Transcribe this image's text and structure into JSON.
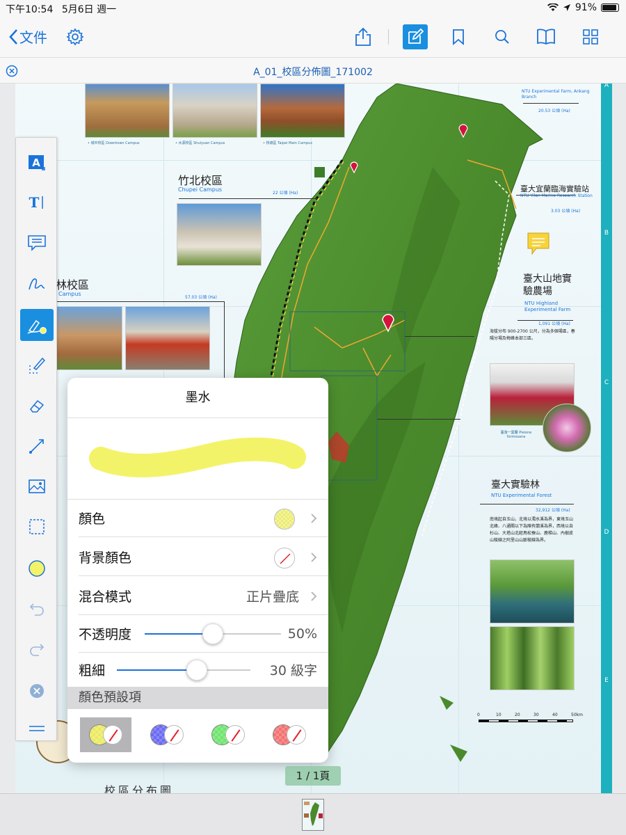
{
  "status_bar": {
    "time": "下午10:54",
    "date": "5月6日 週一",
    "battery": "91%",
    "battery_level": 0.91
  },
  "toolbar": {
    "back_label": "文件"
  },
  "document": {
    "title": "A_01_校區分佈圖_171002",
    "page_indicator": "1 / 1頁"
  },
  "map": {
    "side_letters": [
      "A",
      "B",
      "C",
      "D",
      "E"
    ],
    "captions": {
      "downtown": "• 城中校區 Downtown Campus",
      "shuiyuan": "• 水源校區 Shuiyuan Campus",
      "main": "• 校總區 Taipei Main Campus"
    },
    "chupei": {
      "title": "竹北校區",
      "subtitle": "Chupei Campus",
      "area": "22 公頃 (Ha)"
    },
    "yunlin": {
      "title": "林校區",
      "subtitle": "Campus",
      "area": "57.03 公頃 (Ha)"
    },
    "ankang": {
      "subtitle": "NTU Experimental Farm, Ankang Branch",
      "area": "20.53 公頃 (Ha)"
    },
    "yilan": {
      "title": "臺大宜蘭臨海實驗站",
      "subtitle": "NTU Yilan Marine Research Station",
      "area": "3.03 公頃 (Ha)"
    },
    "highland": {
      "title": "臺大山地實驗農場",
      "subtitle": "NTU Highland Experimental Farm",
      "area": "1,091 公頃 (Ha)",
      "note": "海拔分布 900-2700 公尺，分為多個場區，春陽分場及梅峰本部三區。"
    },
    "forest": {
      "title": "臺大實驗林",
      "subtitle": "NTU Experimental Forest",
      "area": "32,912 公頃 (Ha)",
      "note": "南境起自玉山，北境以濁水溪為界，東境玉山北峰、八通關以下為陳有蘭溪為界，西境以自杉山、大塔山北經鳥松蚕山、鹿梯山、內樹皮山稜線之阿里山山脈稜線為界。"
    },
    "flower_caption": "臺灣一葉蘭 Pleione formosana",
    "scale_labels": [
      "0",
      "10",
      "20",
      "30",
      "40",
      "50km"
    ],
    "bottom_title": "校區分布圖"
  },
  "ink_panel": {
    "title": "墨水",
    "color_label": "顏色",
    "bg_color_label": "背景顏色",
    "blend_label": "混合模式",
    "blend_value": "正片疊底",
    "opacity_label": "不透明度",
    "opacity_value": "50%",
    "opacity_level": 0.5,
    "thickness_label": "粗細",
    "thickness_value": "30 級字",
    "thickness_level": 0.6,
    "presets_label": "顏色預設項",
    "presets": [
      {
        "color": "#f3f36a"
      },
      {
        "color": "#6a6af3"
      },
      {
        "color": "#6ee66e"
      },
      {
        "color": "#f37272"
      }
    ],
    "ink_color": "#f3f36a"
  }
}
